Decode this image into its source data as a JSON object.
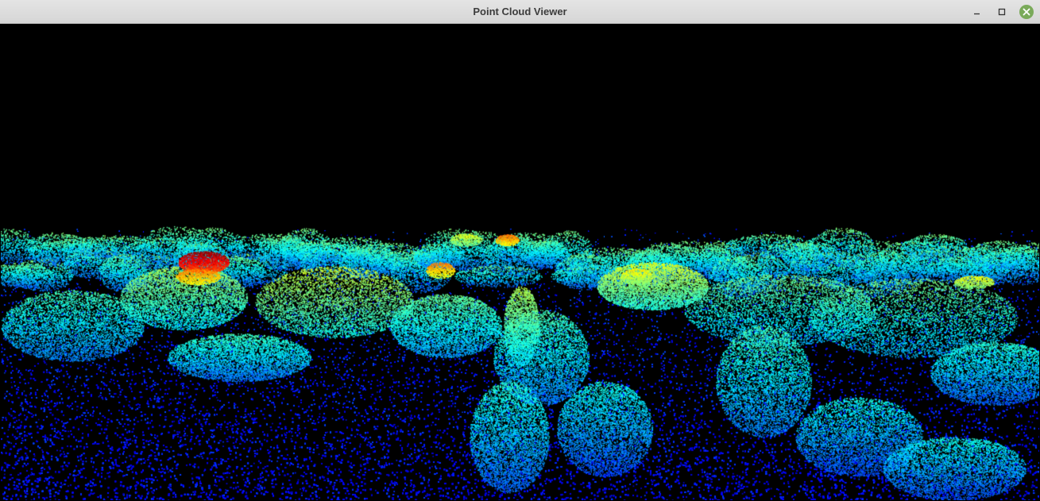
{
  "window": {
    "title": "Point Cloud Viewer",
    "controls": {
      "minimize_icon": "minimize-icon",
      "maximize_icon": "maximize-icon",
      "close_icon": "close-icon"
    },
    "close_color": "#7aaa5a"
  },
  "viewer": {
    "background": "#000000",
    "colormap": "jet",
    "colormap_stops": [
      "#00007f",
      "#0000ff",
      "#007fff",
      "#00ffff",
      "#7fff7f",
      "#ffff00",
      "#ff7f00",
      "#ff0000"
    ]
  }
}
